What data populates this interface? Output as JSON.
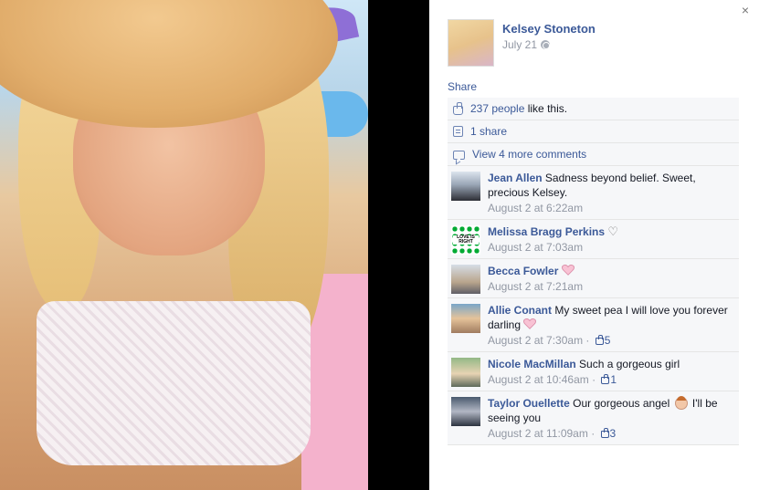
{
  "post": {
    "author_name": "Kelsey Stoneton",
    "date": "July 21",
    "share_link": "Share"
  },
  "close_icon": "×",
  "ufi": {
    "likes_count": "237 people",
    "likes_suffix": " like this.",
    "shares": "1 share",
    "view_more": "View 4 more comments"
  },
  "comments": [
    {
      "name": "Jean Allen",
      "text": "Sadness beyond belief. Sweet, precious Kelsey.",
      "time": "August 2 at 6:22am",
      "likes": ""
    },
    {
      "name": "Melissa Bragg Perkins",
      "text": "♡",
      "time": "August 2 at 7:03am",
      "likes": "",
      "avatar_text": "LOVE IS RIGHT"
    },
    {
      "name": "Becca Fowler",
      "text": "",
      "time": "August 2 at 7:21am",
      "likes": ""
    },
    {
      "name": "Allie Conant",
      "text": "My sweet pea I will love you forever darling",
      "time": "August 2 at 7:30am",
      "likes": "5"
    },
    {
      "name": "Nicole MacMillan",
      "text": "Such a gorgeous girl",
      "time": "August 2 at 10:46am",
      "likes": "1"
    },
    {
      "name": "Taylor Ouellette",
      "text": "Our gorgeous angel",
      "text_after": " I'll be seeing you",
      "time": "August 2 at 11:09am",
      "likes": "3"
    }
  ],
  "icons": {
    "like": "like-icon",
    "share": "share-icon",
    "comment": "comment-icon",
    "globe": "globe-icon",
    "heart": "heart-icon",
    "angel": "angel-emoji-icon"
  },
  "colors": {
    "link": "#3b5998",
    "muted": "#9197a3",
    "heart": "#f4a6c0"
  }
}
